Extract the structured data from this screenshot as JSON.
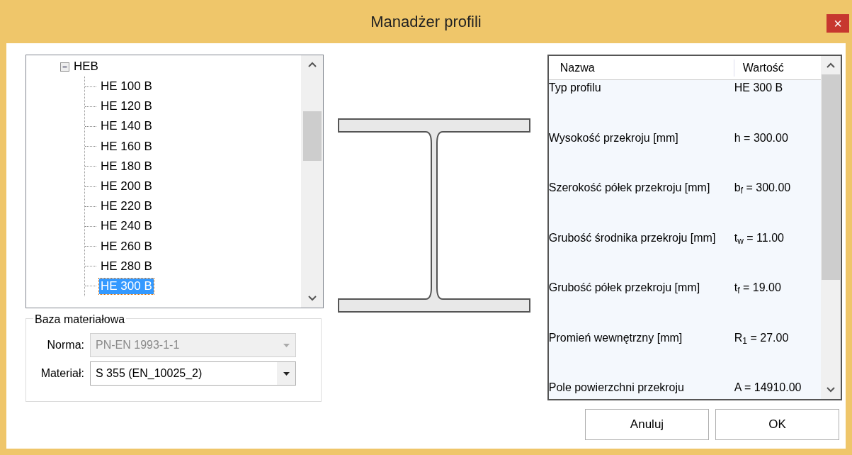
{
  "window": {
    "title": "Manadżer profili",
    "close": "×"
  },
  "tree": {
    "label": "HEB",
    "expanded": true,
    "children": [
      {
        "label": "HE 100 B",
        "selected": false
      },
      {
        "label": "HE 120 B",
        "selected": false
      },
      {
        "label": "HE 140 B",
        "selected": false
      },
      {
        "label": "HE 160 B",
        "selected": false
      },
      {
        "label": "HE 180 B",
        "selected": false
      },
      {
        "label": "HE 200 B",
        "selected": false
      },
      {
        "label": "HE 220 B",
        "selected": false
      },
      {
        "label": "HE 240 B",
        "selected": false
      },
      {
        "label": "HE 260 B",
        "selected": false
      },
      {
        "label": "HE 280 B",
        "selected": false
      },
      {
        "label": "HE 300 B",
        "selected": true
      }
    ]
  },
  "material_group": {
    "title": "Baza materiałowa",
    "fields": [
      {
        "label": "Norma:",
        "value": "PN-EN 1993-1-1",
        "disabled": true
      },
      {
        "label": "Materiał:",
        "value": "S 355 (EN_10025_2)",
        "disabled": false
      }
    ]
  },
  "properties": {
    "columns": [
      "Nazwa",
      "Wartość"
    ],
    "rows": [
      {
        "name": "Typ profilu",
        "value": "HE 300 B"
      },
      {
        "name": "Wysokość przekroju [mm]",
        "value": "h = 300.00"
      },
      {
        "name": "Szerokość półek przekroju [mm]",
        "value": "b$_{f}$ = 300.00"
      },
      {
        "name": "Grubość środnika przekroju [mm]",
        "value": "t$_{w}$ = 11.00"
      },
      {
        "name": "Grubość półek przekroju [mm]",
        "value": "t$_{f}$ = 19.00"
      },
      {
        "name": "Promień wewnętrzny [mm]",
        "value": "R$_{1}$ = 27.00"
      },
      {
        "name": "Pole powierzchni przekroju",
        "value": "A = 14910.00"
      }
    ]
  },
  "buttons": [
    "Anuluj",
    "OK"
  ]
}
